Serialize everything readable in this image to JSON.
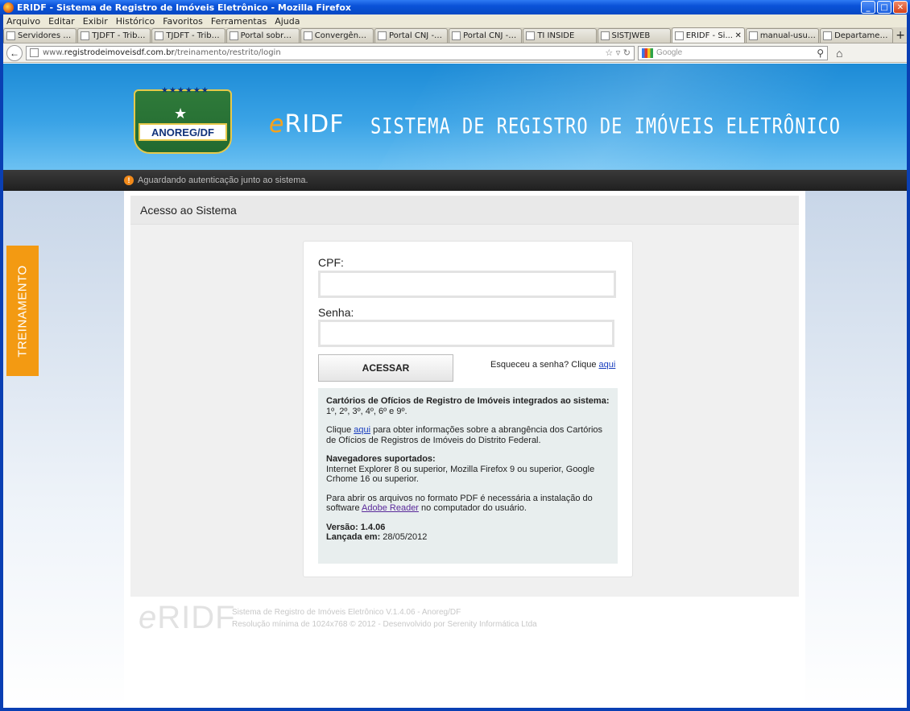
{
  "window": {
    "title": "ERIDF - Sistema de Registro de Imóveis Eletrônico - Mozilla Firefox"
  },
  "menu": [
    "Arquivo",
    "Editar",
    "Exibir",
    "Histórico",
    "Favoritos",
    "Ferramentas",
    "Ajuda"
  ],
  "tabs": [
    {
      "label": "Servidores / L..."
    },
    {
      "label": "TJDFT - Tribu..."
    },
    {
      "label": "TJDFT - Tribu..."
    },
    {
      "label": "Portal sobre t..."
    },
    {
      "label": "Convergência..."
    },
    {
      "label": "Portal CNJ - E..."
    },
    {
      "label": "Portal CNJ - C..."
    },
    {
      "label": "TI INSIDE"
    },
    {
      "label": "SISTJWEB"
    },
    {
      "label": "ERIDF - Si...",
      "active": true
    },
    {
      "label": "manual-usuari..."
    },
    {
      "label": "Departament..."
    }
  ],
  "nav": {
    "url_prefix": "www.",
    "url_domain": "registrodeimoveisdf.com.br",
    "url_path": "/treinamento/restrito/login",
    "search_placeholder": "Google"
  },
  "header": {
    "logo_text": "ANOREG/DF",
    "logo_stars": "★★★★★★",
    "brand_e": "e",
    "brand_rest": "RIDF",
    "system_title": "SISTEMA DE REGISTRO DE IMÓVEIS ELETRÔNICO"
  },
  "status": {
    "message": "Aguardando autenticação junto ao sistema."
  },
  "training_label": "TREINAMENTO",
  "section_title": "Acesso ao Sistema",
  "login": {
    "cpf_label": "CPF:",
    "cpf_value": "",
    "password_label": "Senha:",
    "password_value": "",
    "submit_label": "ACESSAR",
    "forgot_text": "Esqueceu a senha? Clique ",
    "forgot_link": "aqui"
  },
  "info": {
    "cartorios_title": "Cartórios de Ofícios de Registro de Imóveis integrados ao sistema:",
    "cartorios_list": "1º, 2º, 3º, 4º, 6º e 9º.",
    "click_prefix": "Clique ",
    "click_link": "aqui",
    "click_suffix": " para obter informações sobre a abrangência dos Cartórios de Ofícios de Registros de Imóveis do Distrito Federal.",
    "browsers_title": "Navegadores suportados:",
    "browsers_text": "Internet Explorer 8 ou superior, Mozilla Firefox 9 ou superior, Google Crhome 16 ou superior.",
    "pdf_prefix": "Para abrir os arquivos no formato PDF é necessária a instalação do software ",
    "pdf_link": "Adobe Reader",
    "pdf_suffix": " no computador do usuário.",
    "version_label": "Versão:",
    "version_value": " 1.4.06",
    "release_label": "Lançada em:",
    "release_value": " 28/05/2012"
  },
  "footer": {
    "logo_e": "e",
    "logo_rest": "RIDF",
    "line1": "Sistema de Registro de Imóveis Eletrônico V.1.4.06 - Anoreg/DF",
    "line2": "Resolução mínima de 1024x768 © 2012 - Desenvolvido por Serenity Informática Ltda"
  },
  "colors": {
    "header_blue": "#1d8bd6",
    "training_orange": "#f39a12",
    "brand_orange": "#f7a21b",
    "link_blue": "#1b3fbf"
  }
}
